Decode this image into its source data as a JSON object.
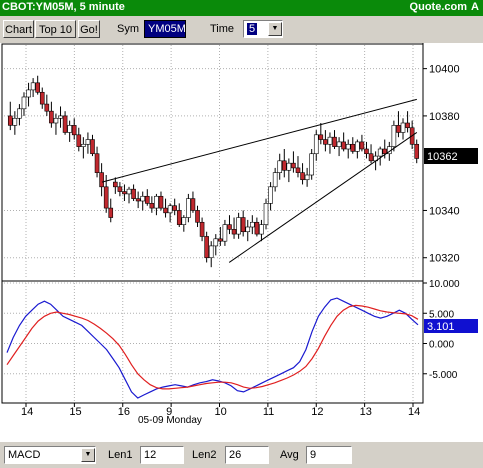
{
  "window": {
    "title": "CBOT:YM05M, 5 minute",
    "brand": "Quote.com",
    "corner": "A"
  },
  "toolbar": {
    "chart_label": "Chart",
    "top10_label": "Top 10",
    "go_label": "Go!",
    "sym_label": "Sym",
    "sym_value": "YM05M",
    "time_label": "Time",
    "time_value": "5"
  },
  "bottom": {
    "study_value": "MACD",
    "len1_label": "Len1",
    "len1_value": "12",
    "len2_label": "Len2",
    "len2_value": "26",
    "avg_label": "Avg",
    "avg_value": "9"
  },
  "colors": {
    "title_bg": "#0a8a0a",
    "up_candle": "#ffffff",
    "down_candle": "#c0282e",
    "macd_line": "#1a1ad0",
    "signal_line": "#e02020",
    "current_price_bg": "#000000",
    "current_macd_bg": "#1010d0"
  },
  "chart_data": [
    {
      "type": "candlestick",
      "price_axis_ticks": [
        "10400",
        "10380",
        "10362",
        "10340",
        "10320"
      ],
      "current_price": "10362",
      "ylim": [
        10311,
        10410
      ],
      "x_ticks": [
        "14",
        "15",
        "16",
        "9",
        "10",
        "11",
        "12",
        "13",
        "14"
      ],
      "date_label": "05-09 Monday",
      "trendlines": [
        {
          "from": [
            0.235,
            10352
          ],
          "to": [
            0.99,
            10387
          ]
        },
        {
          "from": [
            0.54,
            10318
          ],
          "to": [
            0.99,
            10373
          ]
        }
      ],
      "candles": [
        [
          10380,
          10386,
          10374,
          10376
        ],
        [
          10376,
          10382,
          10372,
          10379
        ],
        [
          10379,
          10385,
          10376,
          10383
        ],
        [
          10383,
          10390,
          10380,
          10388
        ],
        [
          10388,
          10394,
          10384,
          10391
        ],
        [
          10391,
          10396,
          10388,
          10394
        ],
        [
          10394,
          10397,
          10389,
          10390
        ],
        [
          10390,
          10392,
          10383,
          10385
        ],
        [
          10385,
          10389,
          10380,
          10382
        ],
        [
          10382,
          10386,
          10375,
          10377
        ],
        [
          10377,
          10381,
          10372,
          10379
        ],
        [
          10379,
          10384,
          10375,
          10380
        ],
        [
          10380,
          10382,
          10372,
          10373
        ],
        [
          10373,
          10378,
          10369,
          10376
        ],
        [
          10376,
          10379,
          10370,
          10372
        ],
        [
          10372,
          10375,
          10365,
          10367
        ],
        [
          10367,
          10371,
          10362,
          10368
        ],
        [
          10368,
          10373,
          10364,
          10370
        ],
        [
          10370,
          10372,
          10363,
          10364
        ],
        [
          10364,
          10367,
          10354,
          10356
        ],
        [
          10356,
          10360,
          10346,
          10350
        ],
        [
          10350,
          10355,
          10339,
          10341
        ],
        [
          10341,
          10345,
          10335,
          10337
        ],
        [
          10352,
          10354,
          10347,
          10350
        ],
        [
          10350,
          10352,
          10346,
          10348
        ],
        [
          10348,
          10351,
          10344,
          10347
        ],
        [
          10347,
          10350,
          10343,
          10349
        ],
        [
          10349,
          10351,
          10344,
          10345
        ],
        [
          10345,
          10348,
          10341,
          10344
        ],
        [
          10344,
          10348,
          10340,
          10346
        ],
        [
          10346,
          10349,
          10342,
          10343
        ],
        [
          10343,
          10346,
          10339,
          10341
        ],
        [
          10341,
          10347,
          10338,
          10346
        ],
        [
          10346,
          10348,
          10340,
          10341
        ],
        [
          10341,
          10345,
          10337,
          10339
        ],
        [
          10339,
          10343,
          10335,
          10342
        ],
        [
          10342,
          10345,
          10338,
          10340
        ],
        [
          10340,
          10343,
          10333,
          10334
        ],
        [
          10334,
          10338,
          10331,
          10337
        ],
        [
          10337,
          10347,
          10335,
          10345
        ],
        [
          10345,
          10348,
          10339,
          10340
        ],
        [
          10340,
          10342,
          10333,
          10335
        ],
        [
          10335,
          10337,
          10327,
          10329
        ],
        [
          10329,
          10331,
          10318,
          10320
        ],
        [
          10320,
          10327,
          10316,
          10325
        ],
        [
          10325,
          10330,
          10321,
          10328
        ],
        [
          10328,
          10333,
          10325,
          10327
        ],
        [
          10327,
          10336,
          10325,
          10334
        ],
        [
          10334,
          10338,
          10330,
          10332
        ],
        [
          10332,
          10337,
          10328,
          10330
        ],
        [
          10330,
          10339,
          10328,
          10337
        ],
        [
          10337,
          10340,
          10329,
          10331
        ],
        [
          10331,
          10336,
          10327,
          10333
        ],
        [
          10333,
          10338,
          10330,
          10335
        ],
        [
          10335,
          10337,
          10329,
          10330
        ],
        [
          10330,
          10336,
          10327,
          10334
        ],
        [
          10334,
          10345,
          10332,
          10343
        ],
        [
          10343,
          10352,
          10340,
          10350
        ],
        [
          10350,
          10358,
          10348,
          10356
        ],
        [
          10356,
          10364,
          10353,
          10361
        ],
        [
          10361,
          10366,
          10354,
          10357
        ],
        [
          10357,
          10362,
          10352,
          10360
        ],
        [
          10360,
          10365,
          10356,
          10358
        ],
        [
          10358,
          10363,
          10354,
          10356
        ],
        [
          10356,
          10360,
          10351,
          10353
        ],
        [
          10353,
          10358,
          10350,
          10355
        ],
        [
          10355,
          10366,
          10353,
          10364
        ],
        [
          10364,
          10374,
          10361,
          10372
        ],
        [
          10372,
          10377,
          10368,
          10370
        ],
        [
          10370,
          10374,
          10365,
          10368
        ],
        [
          10368,
          10373,
          10364,
          10371
        ],
        [
          10371,
          10374,
          10366,
          10367
        ],
        [
          10367,
          10371,
          10363,
          10369
        ],
        [
          10369,
          10373,
          10365,
          10366
        ],
        [
          10366,
          10370,
          10362,
          10368
        ],
        [
          10368,
          10371,
          10364,
          10365
        ],
        [
          10365,
          10370,
          10362,
          10369
        ],
        [
          10369,
          10372,
          10365,
          10366
        ],
        [
          10366,
          10369,
          10362,
          10364
        ],
        [
          10364,
          10368,
          10360,
          10361
        ],
        [
          10361,
          10365,
          10357,
          10363
        ],
        [
          10363,
          10367,
          10359,
          10366
        ],
        [
          10366,
          10370,
          10362,
          10364
        ],
        [
          10364,
          10369,
          10361,
          10367
        ],
        [
          10367,
          10378,
          10365,
          10376
        ],
        [
          10376,
          10382,
          10371,
          10373
        ],
        [
          10373,
          10379,
          10370,
          10377
        ],
        [
          10377,
          10382,
          10373,
          10375
        ],
        [
          10375,
          10378,
          10366,
          10368
        ],
        [
          10368,
          10370,
          10360,
          10362
        ]
      ]
    },
    {
      "type": "line",
      "title": "MACD",
      "axis_ticks": [
        "10.000",
        "5.000",
        "0.000",
        "-5.000"
      ],
      "current_value": "3.101",
      "ylim": [
        -9.5,
        10
      ],
      "series": [
        {
          "values": [
            -1.5,
            1,
            3,
            4.5,
            5.5,
            6.5,
            7,
            6.5,
            5.5,
            4.5,
            4,
            3.5,
            3,
            2,
            1,
            0,
            -1,
            -2.5,
            -4,
            -6,
            -8,
            -9,
            -8.5,
            -8,
            -7.5,
            -7.2,
            -7,
            -6.8,
            -7,
            -7.2,
            -6.8,
            -6.5,
            -6.3,
            -6,
            -6.2,
            -6.5,
            -7,
            -7.8,
            -8,
            -7.5,
            -7,
            -6.5,
            -6,
            -5.5,
            -5,
            -4.5,
            -4,
            -3,
            -1,
            2,
            4.5,
            6,
            7.2,
            7.5,
            7,
            6.5,
            6,
            5.5,
            5,
            4.5,
            4.2,
            4.5,
            5,
            5.5,
            5,
            4,
            3.1
          ]
        },
        {
          "values": [
            -3.5,
            -2,
            -0.5,
            1,
            2.5,
            3.7,
            4.5,
            5,
            5.2,
            5,
            4.8,
            4.5,
            4.2,
            3.8,
            3.2,
            2.5,
            1.7,
            0.8,
            -0.3,
            -1.8,
            -3.5,
            -5,
            -6,
            -6.8,
            -7.3,
            -7.5,
            -7.5,
            -7.4,
            -7.3,
            -7.2,
            -7,
            -6.8,
            -6.6,
            -6.5,
            -6.4,
            -6.4,
            -6.5,
            -6.8,
            -7.2,
            -7.4,
            -7.3,
            -7.1,
            -6.8,
            -6.5,
            -6.1,
            -5.7,
            -5.2,
            -4.6,
            -3.8,
            -2.5,
            -0.8,
            1.2,
            3,
            4.5,
            5.5,
            6.1,
            6.3,
            6.2,
            6,
            5.7,
            5.4,
            5.2,
            5.1,
            5,
            4.9,
            4.6,
            4
          ]
        }
      ]
    }
  ]
}
